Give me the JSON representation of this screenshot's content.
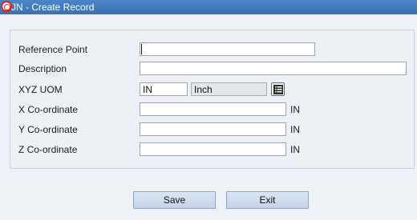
{
  "window": {
    "title": "JN - Create Record"
  },
  "form": {
    "reference_point_label": "Reference Point",
    "reference_point_value": "",
    "description_label": "Description",
    "description_value": "",
    "xyz_uom_label": "XYZ UOM",
    "xyz_uom_code": "IN",
    "xyz_uom_name": "Inch",
    "x_label": "X Co-ordinate",
    "x_value": "",
    "x_unit": "IN",
    "y_label": "Y Co-ordinate",
    "y_value": "",
    "y_unit": "IN",
    "z_label": "Z Co-ordinate",
    "z_value": "",
    "z_unit": "IN"
  },
  "actions": {
    "save_label": "Save",
    "exit_label": "Exit"
  },
  "icons": {
    "app_icon": "oracle-logo-icon",
    "lookup_icon": "list-lookup-icon"
  }
}
